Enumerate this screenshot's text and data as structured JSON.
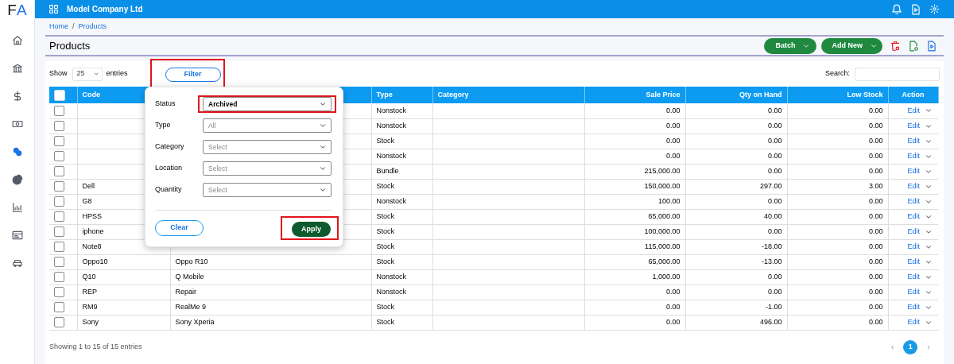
{
  "logo": [
    {
      "text": "F",
      "color": "#111111"
    },
    {
      "text": "A",
      "color": "#1a73e8"
    }
  ],
  "sidebar": {
    "items": [
      {
        "selected": false
      },
      {
        "selected": false
      },
      {
        "selected": false
      },
      {
        "selected": false
      },
      {
        "selected": true
      },
      {
        "selected": false
      },
      {
        "selected": false
      },
      {
        "selected": false
      },
      {
        "selected": false
      }
    ]
  },
  "topbar": {
    "company": "Model Company Ltd"
  },
  "breadcrumb": [
    "Home",
    "Products"
  ],
  "breadcrumb_separator": "/",
  "page_title": "Products",
  "toolbar_buttons": [
    "Batch",
    "Add New"
  ],
  "show_entries": {
    "before": "Show",
    "value": "25",
    "after": "entries"
  },
  "filter_button": {
    "label": "Filter",
    "highlighted": true
  },
  "search": {
    "label": "Search:"
  },
  "filter_panel": {
    "fields": [
      {
        "label": "Status",
        "value": "Archived",
        "highlighted": true
      },
      {
        "label": "Type",
        "placeholder": "All",
        "highlighted": false
      },
      {
        "label": "Category",
        "placeholder": "Select",
        "highlighted": false
      },
      {
        "label": "Location",
        "placeholder": "Select",
        "highlighted": false
      },
      {
        "label": "Quantity",
        "placeholder": "Select",
        "highlighted": false
      }
    ],
    "clear": {
      "label": "Clear"
    },
    "apply": {
      "label": "Apply",
      "highlighted": true
    }
  },
  "table": {
    "select_all": {
      "checked": false
    },
    "columns": [
      "Code",
      null,
      "Type",
      "Category",
      "Sale Price",
      "Qty on Hand",
      "Low Stock",
      "Action"
    ],
    "rows": [
      {
        "checked": false,
        "type": "Nonstock",
        "sale_price": "0.00",
        "qty_on_hand": "0.00",
        "low_stock": "0.00",
        "action": "Edit"
      },
      {
        "checked": false,
        "type": "Nonstock",
        "sale_price": "0.00",
        "qty_on_hand": "0.00",
        "low_stock": "0.00",
        "action": "Edit"
      },
      {
        "checked": false,
        "type": "Stock",
        "sale_price": "0.00",
        "qty_on_hand": "0.00",
        "low_stock": "0.00",
        "action": "Edit"
      },
      {
        "checked": false,
        "type": "Nonstock",
        "sale_price": "0.00",
        "qty_on_hand": "0.00",
        "low_stock": "0.00",
        "action": "Edit"
      },
      {
        "checked": false,
        "type": "Bundle",
        "sale_price": "215,000.00",
        "qty_on_hand": "0.00",
        "low_stock": "0.00",
        "action": "Edit"
      },
      {
        "checked": false,
        "code": "Dell",
        "type": "Stock",
        "sale_price": "150,000.00",
        "qty_on_hand": "297.00",
        "low_stock": "3.00",
        "action": "Edit"
      },
      {
        "checked": false,
        "code": "G8",
        "type": "Nonstock",
        "sale_price": "100.00",
        "qty_on_hand": "0.00",
        "low_stock": "0.00",
        "action": "Edit"
      },
      {
        "checked": false,
        "code": "HPSS",
        "type": "Stock",
        "sale_price": "65,000.00",
        "qty_on_hand": "40.00",
        "low_stock": "0.00",
        "action": "Edit"
      },
      {
        "checked": false,
        "code": "iphone",
        "type": "Stock",
        "sale_price": "100,000.00",
        "qty_on_hand": "0.00",
        "low_stock": "0.00",
        "action": "Edit"
      },
      {
        "checked": false,
        "code": "Note8",
        "type": "Stock",
        "sale_price": "115,000.00",
        "qty_on_hand": "-18.00",
        "low_stock": "0.00",
        "action": "Edit"
      },
      {
        "checked": false,
        "code": "Oppo10",
        "name": "Oppo R10",
        "type": "Stock",
        "sale_price": "65,000.00",
        "qty_on_hand": "-13.00",
        "low_stock": "0.00",
        "action": "Edit"
      },
      {
        "checked": false,
        "code": "Q10",
        "name": "Q Mobile",
        "type": "Nonstock",
        "sale_price": "1,000.00",
        "qty_on_hand": "0.00",
        "low_stock": "0.00",
        "action": "Edit"
      },
      {
        "checked": false,
        "code": "REP",
        "name": "Repair",
        "type": "Nonstock",
        "sale_price": "0.00",
        "qty_on_hand": "0.00",
        "low_stock": "0.00",
        "action": "Edit"
      },
      {
        "checked": false,
        "code": "RM9",
        "name": "RealMe 9",
        "type": "Stock",
        "sale_price": "0.00",
        "qty_on_hand": "-1.00",
        "low_stock": "0.00",
        "action": "Edit"
      },
      {
        "checked": false,
        "code": "Sony",
        "name": "Sony Xperia",
        "type": "Stock",
        "sale_price": "0.00",
        "qty_on_hand": "496.00",
        "low_stock": "0.00",
        "action": "Edit"
      }
    ]
  },
  "footer": {
    "info": "Showing 1 to 15 of 15 entries"
  },
  "pagination": {
    "prev": "‹",
    "pages": [
      {
        "label": "1",
        "selected": true
      }
    ],
    "next": "›"
  }
}
